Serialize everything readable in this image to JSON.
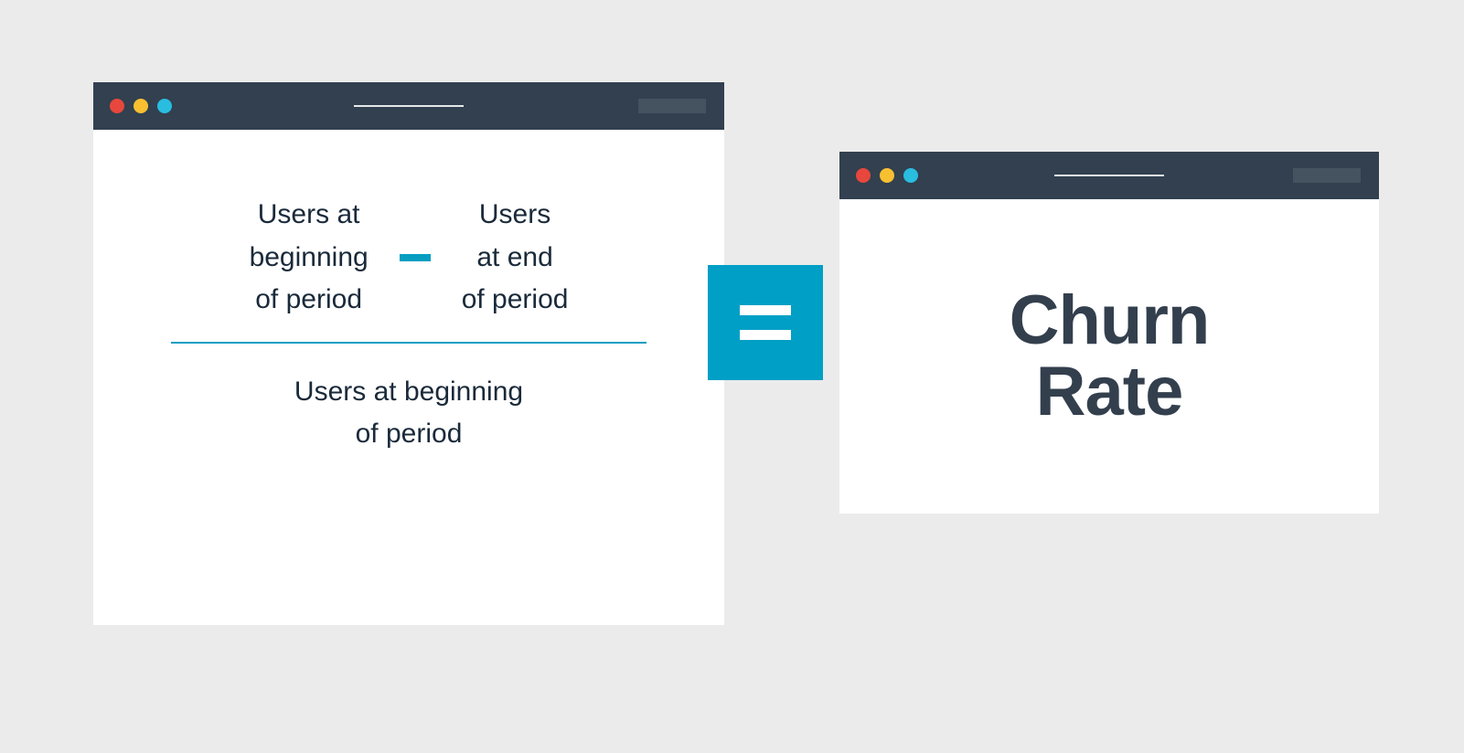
{
  "colors": {
    "background": "#ebebeb",
    "titlebar": "#32404f",
    "titlebarPill": "#45525f",
    "dotRed": "#e7473c",
    "dotYellow": "#f8c031",
    "dotBlue": "#29bde0",
    "accent": "#009fc6",
    "text": "#1a2a3a",
    "resultText": "#333f4d"
  },
  "formula": {
    "numerator": {
      "left": "Users at\nbeginning\nof period",
      "operator": "minus",
      "right": "Users\nat end\nof period"
    },
    "denominator": "Users at beginning\nof period",
    "equals": "=",
    "result": "Churn\nRate"
  }
}
